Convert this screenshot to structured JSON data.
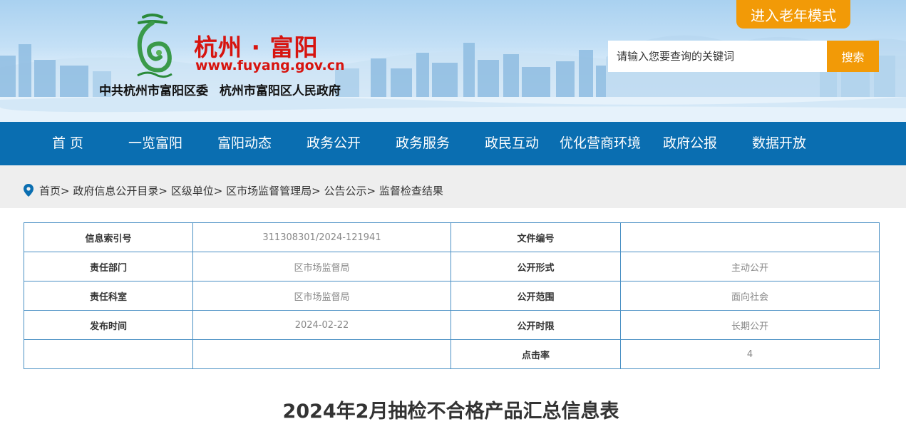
{
  "header": {
    "site_name": "杭州 · 富阳",
    "site_url": "www.fuyang.gov.cn",
    "org_line": "中共杭州市富阳区委 杭州市富阳区人民政府",
    "logo_text": "富阳",
    "elder_mode_label": "进入老年模式",
    "search": {
      "placeholder": "请输入您要查询的关键词",
      "button_label": "搜索"
    },
    "colors": {
      "brand_red": "#d7140f",
      "accent_orange": "#f29a07"
    }
  },
  "nav": {
    "color": "#0a6eb1",
    "items": [
      {
        "label": "首  页"
      },
      {
        "label": "一览富阳"
      },
      {
        "label": "富阳动态"
      },
      {
        "label": "政务公开"
      },
      {
        "label": "政务服务"
      },
      {
        "label": "政民互动"
      },
      {
        "label": "优化营商环境"
      },
      {
        "label": "政府公报"
      },
      {
        "label": "数据开放"
      }
    ]
  },
  "breadcrumb": {
    "icon": "location-pin-icon",
    "items": [
      {
        "label": "首页"
      },
      {
        "label": "政府信息公开目录"
      },
      {
        "label": "区级单位"
      },
      {
        "label": "区市场监督管理局"
      },
      {
        "label": "公告公示"
      },
      {
        "label": "监督检查结果"
      }
    ],
    "separator": ">"
  },
  "info_table": {
    "rows": [
      {
        "label1": "信息索引号",
        "value1": "311308301/2024-121941",
        "label2": "文件编号",
        "value2": ""
      },
      {
        "label1": "责任部门",
        "value1": "区市场监督局",
        "label2": "公开形式",
        "value2": "主动公开"
      },
      {
        "label1": "责任科室",
        "value1": "区市场监督局",
        "label2": "公开范围",
        "value2": "面向社会"
      },
      {
        "label1": "发布时间",
        "value1": "2024-02-22",
        "label2": "公开时限",
        "value2": "长期公开"
      },
      {
        "label1": "",
        "value1": "",
        "label2": "点击率",
        "value2": "4"
      }
    ]
  },
  "article": {
    "title": "2024年2月抽检不合格产品汇总信息表"
  }
}
